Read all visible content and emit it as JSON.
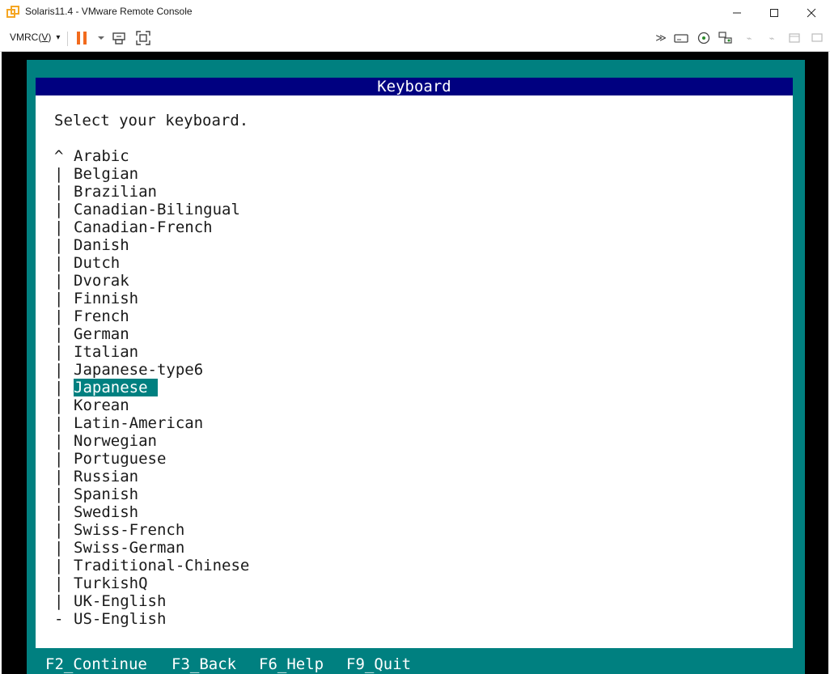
{
  "window": {
    "title": "Solaris11.4 - VMware Remote Console",
    "minimize_glyph": "—",
    "maximize_glyph": "☐",
    "close_glyph": "✕"
  },
  "toolbar": {
    "menu_label_prefix": "VMRC(",
    "menu_label_key": "V",
    "menu_label_suffix": ")",
    "menu_caret": "▾",
    "pause_color": "#f26b1d",
    "right_icons": [
      "send-ctrl-alt-del-icon",
      "removable-devices-icon",
      "connect-device-icon",
      "network-icon",
      "unity-icon",
      "snapshot-icon",
      "power-icon"
    ]
  },
  "console": {
    "header": "Keyboard",
    "prompt": "Select your keyboard.",
    "keyboards": [
      {
        "marker": "^",
        "label": "Arabic"
      },
      {
        "marker": "|",
        "label": "Belgian"
      },
      {
        "marker": "|",
        "label": "Brazilian"
      },
      {
        "marker": "|",
        "label": "Canadian-Bilingual"
      },
      {
        "marker": "|",
        "label": "Canadian-French"
      },
      {
        "marker": "|",
        "label": "Danish"
      },
      {
        "marker": "|",
        "label": "Dutch"
      },
      {
        "marker": "|",
        "label": "Dvorak"
      },
      {
        "marker": "|",
        "label": "Finnish"
      },
      {
        "marker": "|",
        "label": "French"
      },
      {
        "marker": "|",
        "label": "German"
      },
      {
        "marker": "|",
        "label": "Italian"
      },
      {
        "marker": "|",
        "label": "Japanese-type6"
      },
      {
        "marker": "|",
        "label": "Japanese",
        "selected": true
      },
      {
        "marker": "|",
        "label": "Korean"
      },
      {
        "marker": "|",
        "label": "Latin-American"
      },
      {
        "marker": "|",
        "label": "Norwegian"
      },
      {
        "marker": "|",
        "label": "Portuguese"
      },
      {
        "marker": "|",
        "label": "Russian"
      },
      {
        "marker": "|",
        "label": "Spanish"
      },
      {
        "marker": "|",
        "label": "Swedish"
      },
      {
        "marker": "|",
        "label": "Swiss-French"
      },
      {
        "marker": "|",
        "label": "Swiss-German"
      },
      {
        "marker": "|",
        "label": "Traditional-Chinese"
      },
      {
        "marker": "|",
        "label": "TurkishQ"
      },
      {
        "marker": "|",
        "label": "UK-English"
      },
      {
        "marker": "-",
        "label": "US-English"
      }
    ],
    "footer": {
      "f2": "F2_Continue",
      "f3": "F3_Back",
      "f6": "F6_Help",
      "f9": "F9_Quit"
    },
    "colors": {
      "teal": "#008080",
      "navy": "#000080"
    }
  }
}
